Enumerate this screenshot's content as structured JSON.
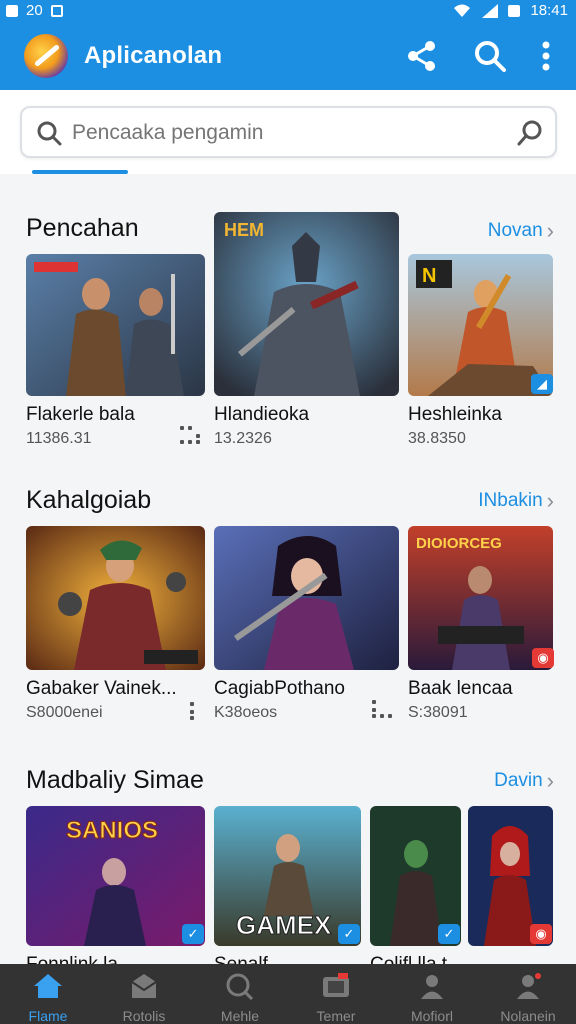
{
  "statusbar": {
    "time": "18:41",
    "left_text": "20"
  },
  "appbar": {
    "title": "Aplicanolan"
  },
  "search": {
    "placeholder": "Pencaaka pengamin"
  },
  "sections": [
    {
      "title": "Pencahan",
      "link": "Novan",
      "cards": [
        {
          "name": "Flakerle bala",
          "meta": "11386.31",
          "badge": ""
        },
        {
          "name": "Hlandieoka",
          "meta": "13.2326",
          "badge": ""
        },
        {
          "name": "Heshleinka",
          "meta": "38.8350",
          "badge": "◢"
        }
      ]
    },
    {
      "title": "Kahalgoiab",
      "link": "INbakin",
      "cards": [
        {
          "name": "Gabaker Vainek...",
          "meta": "S8000enei",
          "badge": "◉"
        },
        {
          "name": "CagiabРothano",
          "meta": "K38oeos",
          "badge": ""
        },
        {
          "name": "Baak lencaa",
          "meta": "S:38091",
          "badge": "◉"
        }
      ]
    },
    {
      "title": "Madbaliy Simae",
      "link": "Davin",
      "cards": [
        {
          "name": "Sanlos",
          "meta": "",
          "badge": "✓"
        },
        {
          "name": "GAMEX",
          "meta": "",
          "badge": "✓"
        },
        {
          "name": "",
          "meta": "",
          "badge": "✓"
        },
        {
          "name": "",
          "meta": "",
          "badge": "◉"
        }
      ]
    }
  ],
  "thumb_titles": {
    "s1c1": "",
    "s1c2": "HEM",
    "s1c3": "N",
    "s2c3": "DIOIORCEG",
    "s3c1": "SANIOS",
    "s3c2": "GAMEX"
  },
  "row3_names": [
    "Fonnlink la",
    "Senalf",
    "Colifl lla t",
    ""
  ],
  "bottomnav": [
    {
      "label": "Flame",
      "icon": "home-icon",
      "active": true
    },
    {
      "label": "Rotolis",
      "icon": "mail-icon",
      "active": false
    },
    {
      "label": "Mehle",
      "icon": "search-icon",
      "active": false
    },
    {
      "label": "Temer",
      "icon": "tv-icon",
      "active": false
    },
    {
      "label": "Mofiorl",
      "icon": "person-icon",
      "active": false
    },
    {
      "label": "Nolanein",
      "icon": "profile-icon",
      "active": false
    }
  ],
  "colors": {
    "primary": "#1d8fe3",
    "nav_bg": "#333333",
    "active_nav": "#3aa0f0"
  }
}
